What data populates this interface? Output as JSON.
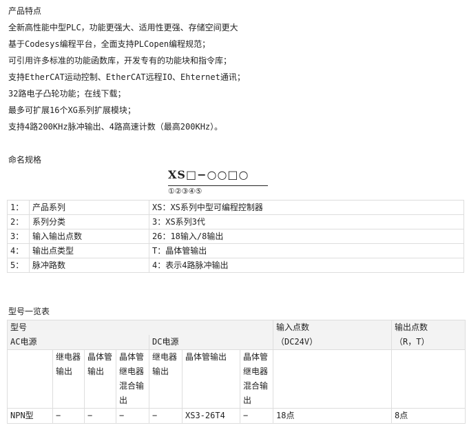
{
  "features": {
    "title": "产品特点",
    "items": [
      "全新高性能中型PLC，功能更强大、适用性更强、存储空间更大",
      "基于Codesys编程平台，全面支持PLCopen编程规范；",
      "可引用许多标准的功能函数库，开发专有的功能块和指令库；",
      "支持EtherCAT运动控制、EtherCAT远程IO、Ehternet通讯；",
      "32路电子凸轮功能；在线下载；",
      "最多可扩展16个XG系列扩展模块；",
      "支持4路200KHz脉冲输出、4路高速计数（最高200KHz）。"
    ]
  },
  "naming": {
    "title": "命名规格",
    "diagram_top": "XS□−○○□○",
    "diagram_nums": "①②③④⑤",
    "rows": [
      [
        "1：",
        "产品系列",
        "XS：XS系列中型可编程控制器"
      ],
      [
        "2：",
        "系列分类",
        "3：XS系列3代"
      ],
      [
        "3：",
        "输入输出点数",
        "26：18输入/8输出"
      ],
      [
        "4：",
        "输出点类型",
        "T：晶体管输出"
      ],
      [
        "5：",
        "脉冲路数",
        "4：表示4路脉冲输出"
      ]
    ]
  },
  "models": {
    "title": "型号一览表",
    "h_model": "型号",
    "h_ac": "AC电源",
    "h_dc": "DC电源",
    "h_input": "输入点数",
    "h_input_sub": "（DC24V）",
    "h_output": "输出点数",
    "h_output_sub": "（R，T）",
    "sub_headers": [
      "继电器输出",
      "晶体管输出",
      "晶体管继电器混合输出",
      "继电器输出",
      "晶体管输出",
      "晶体管继电器混合输出"
    ],
    "row": {
      "type": "NPN型",
      "ac_relay": "−",
      "ac_transistor": "−",
      "ac_mixed": "−",
      "dc_relay": "−",
      "dc_transistor": "XS3-26T4",
      "dc_mixed": "−",
      "input": "18点",
      "output": "8点"
    }
  }
}
